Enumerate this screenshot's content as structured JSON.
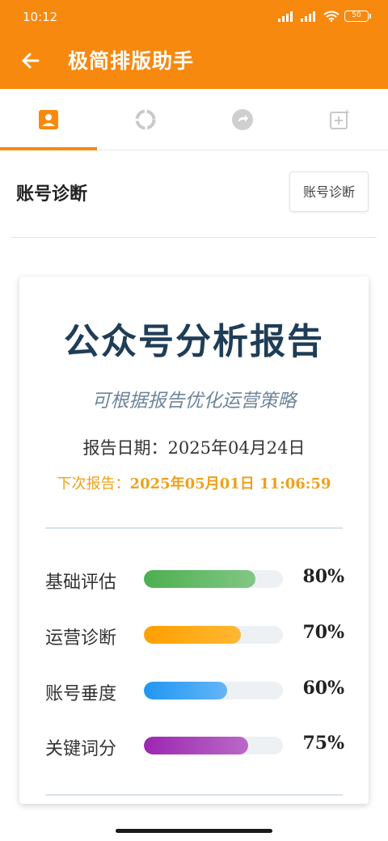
{
  "status_bar": {
    "time": "10:12",
    "battery": "50"
  },
  "app_bar": {
    "title": "极简排版助手"
  },
  "tabs": [
    {
      "icon": "person-icon",
      "active": true
    },
    {
      "icon": "loading-ring-icon",
      "active": false
    },
    {
      "icon": "refresh-circle-icon",
      "active": false
    },
    {
      "icon": "add-sparkle-icon",
      "active": false
    }
  ],
  "section": {
    "title": "账号诊断",
    "button_label": "账号诊断"
  },
  "report": {
    "title": "公众号分析报告",
    "subtitle": "可根据报告优化运营策略",
    "date_label": "报告日期：",
    "date_value": "2025年04月24日",
    "next_label": "下次报告：",
    "next_value": "2025年05月01日 11:06:59"
  },
  "metrics": [
    {
      "label": "基础评估",
      "value": "80%",
      "percent": 80,
      "color_start": "#4caf50",
      "color_end": "#81c784"
    },
    {
      "label": "运营诊断",
      "value": "70%",
      "percent": 70,
      "color_start": "#ff9f00",
      "color_end": "#ffb733"
    },
    {
      "label": "账号垂度",
      "value": "60%",
      "percent": 60,
      "color_start": "#2196f3",
      "color_end": "#64b5f6"
    },
    {
      "label": "关键词分",
      "value": "75%",
      "percent": 75,
      "color_start": "#9c27b0",
      "color_end": "#ba68c8"
    }
  ],
  "colors": {
    "accent": "#f7890f",
    "title": "#1f3d57",
    "next_report": "#f0a01a"
  }
}
